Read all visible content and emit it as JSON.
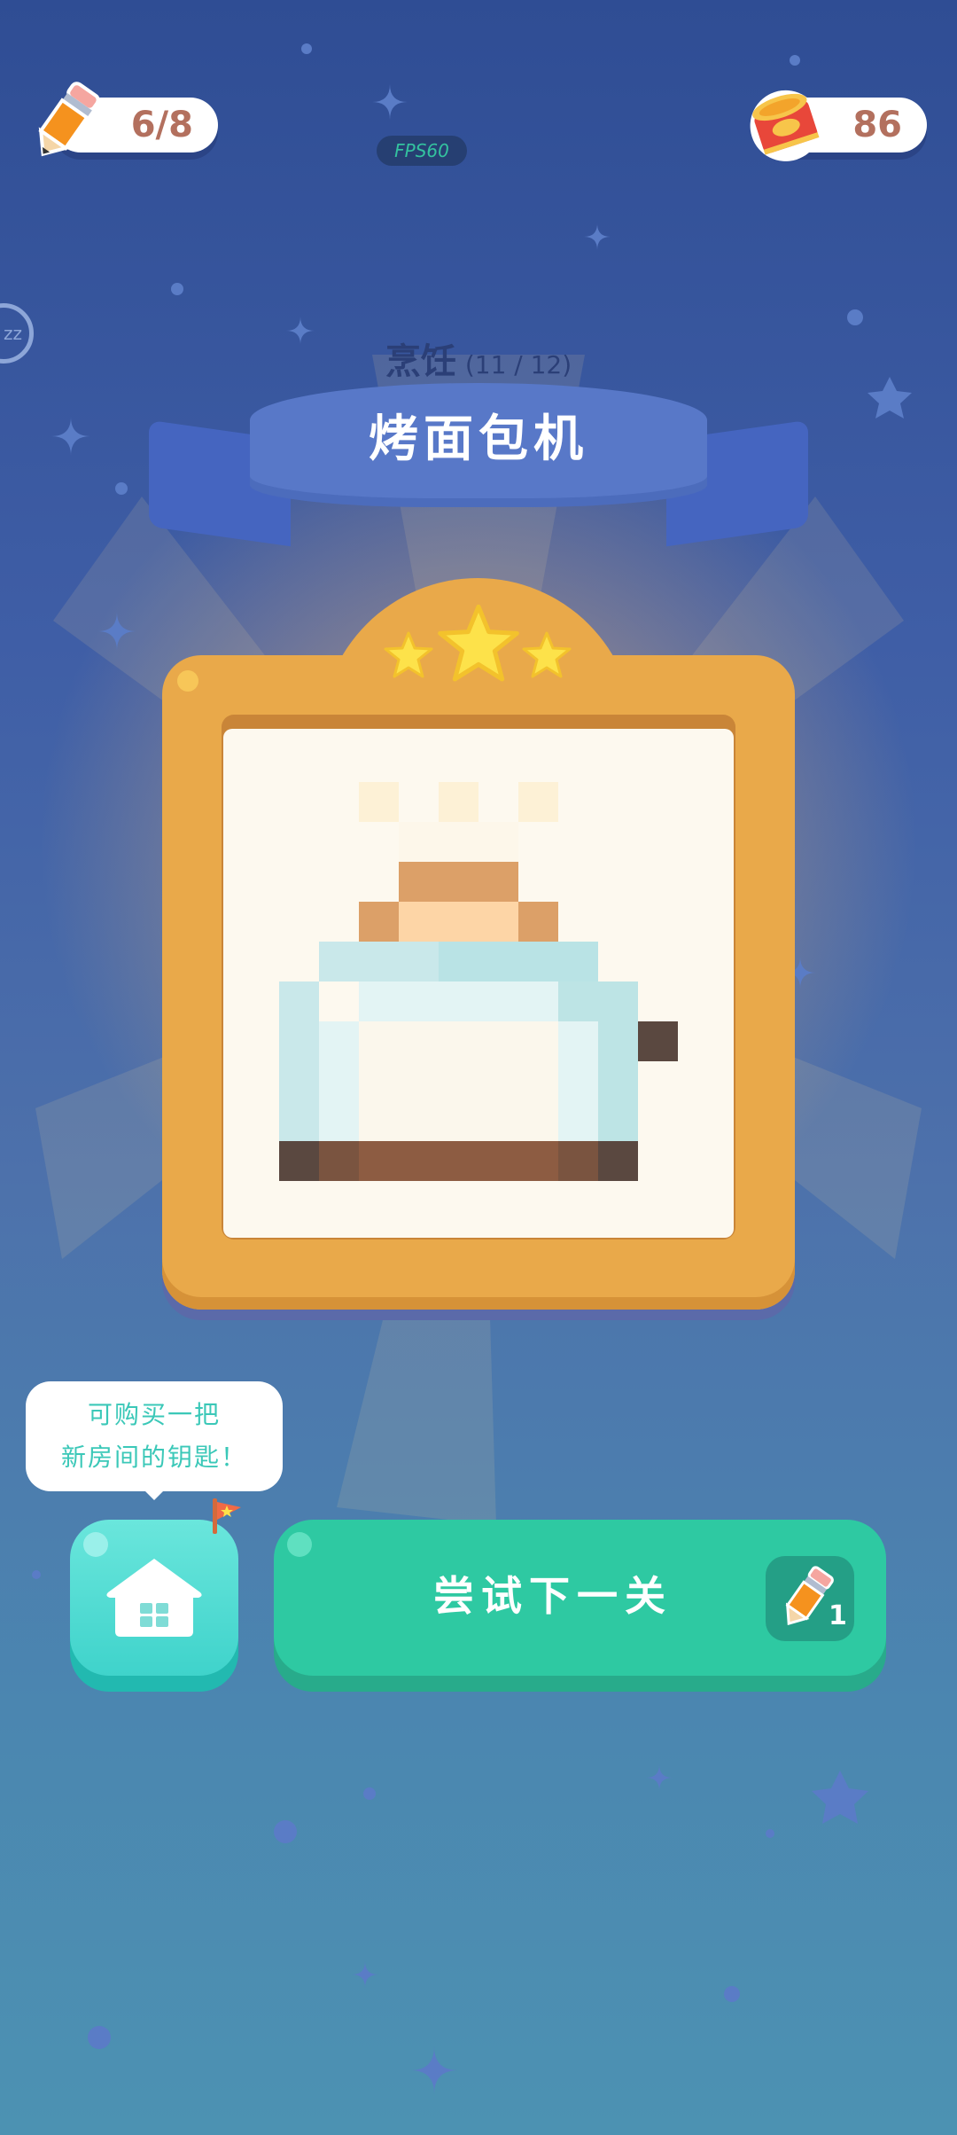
{
  "hud": {
    "pencils": "6/8",
    "coins": "86",
    "fps": "FPS60",
    "sleep": "zz"
  },
  "level": {
    "category": "烹饪",
    "progress": "(11 / 12)",
    "title": "烤面包机",
    "stars_earned": 3,
    "stars_total": 3
  },
  "tooltip": {
    "line1": "可购买一把",
    "line2": "新房间的钥匙！"
  },
  "buttons": {
    "home_icon": "house-icon",
    "next_label": "尝试下一关",
    "next_cost": "1",
    "next_cost_icon": "pencil-icon"
  },
  "colors": {
    "accent_green": "#2ec9a2",
    "accent_teal": "#3fd3cb",
    "frame_orange": "#e9a94a",
    "ribbon_blue": "#5878c8"
  }
}
